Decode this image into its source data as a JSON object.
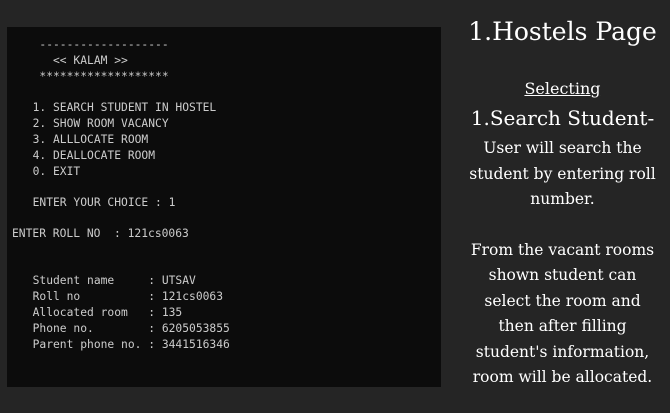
{
  "terminal": {
    "lines": [
      "   -------------------",
      "     << KALAM >>",
      "   *******************",
      "  1. SEARCH STUDENT IN HOSTEL",
      "  2. SHOW ROOM VACANCY",
      "  3. ALLLOCATE ROOM",
      "  4. DEALLOCATE ROOM",
      "  0. EXIT",
      "  ENTER YOUR CHOICE : 1",
      "ENTER ROLL NO  : 121cs0063",
      "  Student name     : UTSAV",
      "  Roll no          : 121cs0063",
      "  Allocated room   : 135",
      "  Phone no.        : 6205053855",
      "  Parent phone no. : 3441516346"
    ]
  },
  "caption": {
    "title": "1.Hostels Page",
    "selecting": "Selecting",
    "subtitle": "1.Search Student-",
    "para1": [
      "User will search the",
      "student by entering roll",
      "number."
    ],
    "para2": [
      "From the vacant rooms",
      "shown student can",
      "select the room and",
      "then after filling",
      "student's information,",
      "room will be allocated."
    ]
  }
}
